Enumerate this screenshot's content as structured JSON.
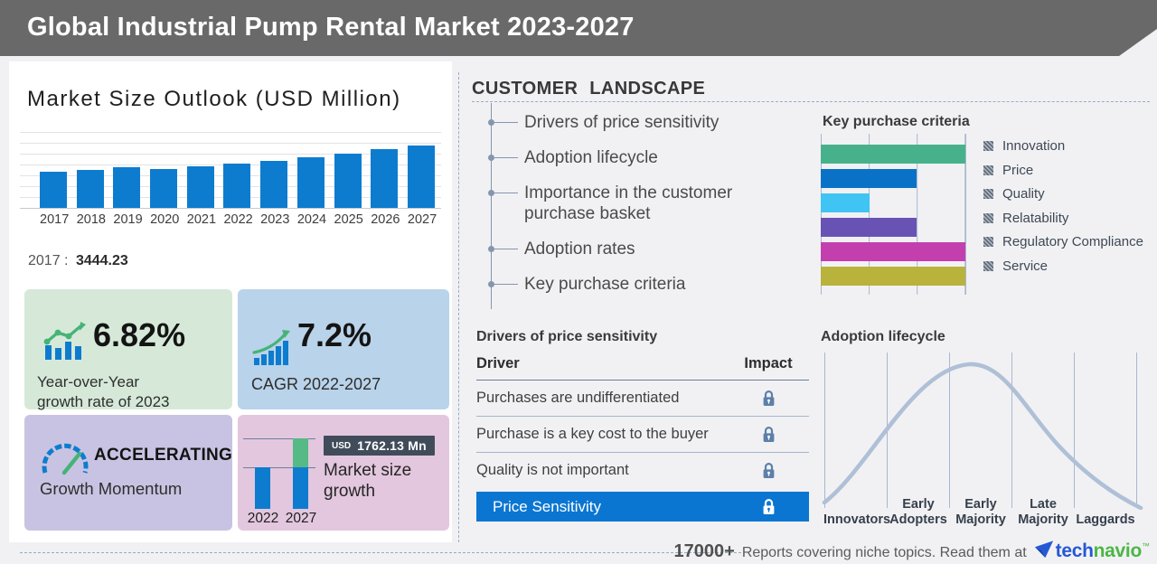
{
  "header": {
    "title": "Global Industrial Pump Rental Market 2023-2027"
  },
  "market": {
    "base_year_label": "2017 :",
    "base_value": "3444.23"
  },
  "stats": {
    "yoy": {
      "value": "6.82%",
      "label": "Year-over-Year\ngrowth rate of 2023"
    },
    "cagr": {
      "value": "7.2%",
      "label": "CAGR 2022-2027"
    },
    "momentum": {
      "value": "ACCELERATING",
      "label": "Growth Momentum"
    },
    "growth": {
      "currency": "USD",
      "amount": "1762.13 Mn",
      "label": "Market size\ngrowth",
      "years": [
        "2022",
        "2027"
      ]
    }
  },
  "landscape": {
    "title": "CUSTOMER LANDSCAPE",
    "items": [
      "Drivers of price sensitivity",
      "Adoption lifecycle",
      "Importance in the customer purchase basket",
      "Adoption rates",
      "Key purchase criteria"
    ]
  },
  "price_table": {
    "title": "Drivers of price sensitivity",
    "col_driver": "Driver",
    "col_impact": "Impact",
    "rows": [
      "Purchases are undifferentiated",
      "Purchase is a key cost to the buyer",
      "Quality is not important"
    ],
    "highlight": "Price Sensitivity"
  },
  "footer": {
    "count": "17000+",
    "text": "Reports covering niche topics. Read them at",
    "brand": {
      "prefix": "tech",
      "suffix": "navio",
      "tm": "™"
    }
  },
  "colors": {
    "accent_blue": "#0d7ccf",
    "highlight_row_blue": "#0b76d1",
    "growth_green": "#55ba86",
    "curve_gray_blue": "#afc0d6",
    "lock_blue_gray": "#5d80a8",
    "header_gray": "#696969",
    "brand_blue": "#2458d5",
    "brand_green": "#4cb644"
  },
  "chart_data": [
    {
      "id": "market_size",
      "type": "bar",
      "title": "Market Size Outlook (USD Million)",
      "categories": [
        "2017",
        "2018",
        "2019",
        "2020",
        "2021",
        "2022",
        "2023",
        "2024",
        "2025",
        "2026",
        "2027"
      ],
      "values": [
        3444.23,
        3670,
        3920,
        3780,
        4040,
        4240,
        4530,
        4890,
        5230,
        5620,
        6000
      ],
      "value_note": "only 2017 labeled on image (3444.23); other values estimated from bar heights",
      "ylabel": "USD Million",
      "ylim": [
        0,
        6500
      ],
      "grid": true,
      "bar_color": "#0d7ccf"
    },
    {
      "id": "key_purchase_criteria",
      "type": "bar",
      "orientation": "horizontal",
      "title": "Key purchase criteria",
      "categories": [
        "Innovation",
        "Price",
        "Quality",
        "Relatability",
        "Regulatory Compliance",
        "Service"
      ],
      "values": [
        100,
        66,
        34,
        66,
        100,
        100
      ],
      "value_note": "percent of axis width, estimated from gridlines (no numeric labels shown)",
      "colors": [
        "#47b18c",
        "#0a72c6",
        "#3fc4f3",
        "#6853b4",
        "#c33fae",
        "#b9b23b"
      ],
      "legend_position": "right",
      "grid": true
    },
    {
      "id": "market_size_growth",
      "type": "bar",
      "categories": [
        "2022",
        "2027"
      ],
      "values": [
        4240,
        6002.13
      ],
      "growth_segment_value": 1762.13,
      "annotation": "USD 1762.13 Mn",
      "value_note": "2027 = 2022 + USD 1762.13 Mn growth; bar split blue (base) / green (growth)"
    },
    {
      "id": "adoption_lifecycle",
      "type": "line",
      "title": "Adoption lifecycle",
      "categories": [
        "Innovators",
        "Early Adopters",
        "Early Majority",
        "Late Majority",
        "Laggards"
      ],
      "shape": "bell curve peaking over Early Majority",
      "grid": true
    }
  ]
}
